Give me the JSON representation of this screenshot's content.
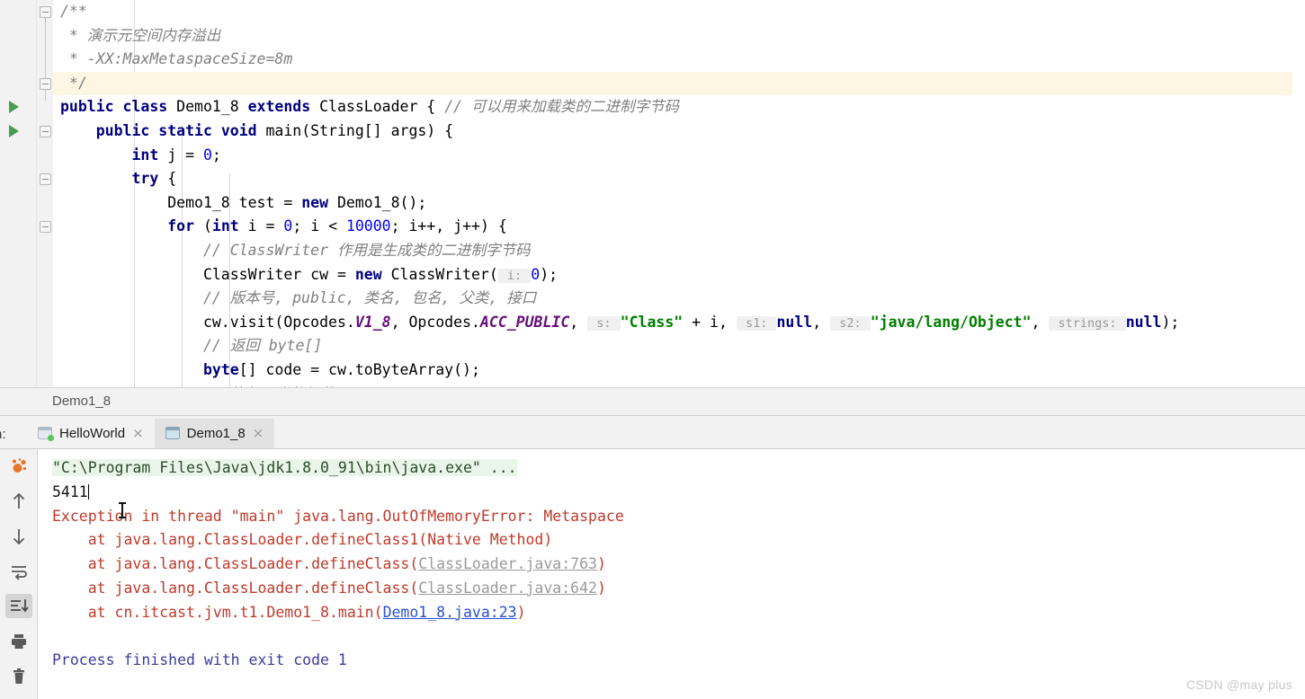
{
  "editor": {
    "lines": [
      {
        "indent": 0,
        "tokens": [
          {
            "t": "doc",
            "v": "/**"
          }
        ]
      },
      {
        "indent": 0,
        "tokens": [
          {
            "t": "doc",
            "v": " * 演示元空间内存溢出"
          }
        ]
      },
      {
        "indent": 0,
        "tokens": [
          {
            "t": "doc",
            "v": " * -XX:MaxMetaspaceSize=8m"
          }
        ]
      },
      {
        "indent": 0,
        "highlight": true,
        "tokens": [
          {
            "t": "doc",
            "v": " */"
          }
        ]
      },
      {
        "indent": 0,
        "tokens": [
          {
            "t": "kw",
            "v": "public class"
          },
          {
            "t": "plain",
            "v": " Demo1_8 "
          },
          {
            "t": "kw",
            "v": "extends"
          },
          {
            "t": "plain",
            "v": " ClassLoader { "
          },
          {
            "t": "cmt",
            "v": "// 可以用来加载类的二进制字节码"
          }
        ]
      },
      {
        "indent": 0,
        "tokens": [
          {
            "t": "plain",
            "v": "    "
          },
          {
            "t": "kw",
            "v": "public static void"
          },
          {
            "t": "plain",
            "v": " main(String[] args) {"
          }
        ]
      },
      {
        "indent": 0,
        "tokens": [
          {
            "t": "plain",
            "v": "        "
          },
          {
            "t": "kw",
            "v": "int"
          },
          {
            "t": "plain",
            "v": " j = "
          },
          {
            "t": "num",
            "v": "0"
          },
          {
            "t": "plain",
            "v": ";"
          }
        ]
      },
      {
        "indent": 0,
        "tokens": [
          {
            "t": "plain",
            "v": "        "
          },
          {
            "t": "kw",
            "v": "try"
          },
          {
            "t": "plain",
            "v": " {"
          }
        ]
      },
      {
        "indent": 0,
        "tokens": [
          {
            "t": "plain",
            "v": "            Demo1_8 test = "
          },
          {
            "t": "kw",
            "v": "new"
          },
          {
            "t": "plain",
            "v": " Demo1_8();"
          }
        ]
      },
      {
        "indent": 0,
        "tokens": [
          {
            "t": "plain",
            "v": "            "
          },
          {
            "t": "kw",
            "v": "for"
          },
          {
            "t": "plain",
            "v": " ("
          },
          {
            "t": "kw",
            "v": "int"
          },
          {
            "t": "plain",
            "v": " i = "
          },
          {
            "t": "num",
            "v": "0"
          },
          {
            "t": "plain",
            "v": "; i < "
          },
          {
            "t": "num",
            "v": "10000"
          },
          {
            "t": "plain",
            "v": "; i++, j++) {"
          }
        ]
      },
      {
        "indent": 0,
        "tokens": [
          {
            "t": "plain",
            "v": "                "
          },
          {
            "t": "cmt",
            "v": "// ClassWriter 作用是生成类的二进制字节码"
          }
        ]
      },
      {
        "indent": 0,
        "tokens": [
          {
            "t": "plain",
            "v": "                ClassWriter cw = "
          },
          {
            "t": "kw",
            "v": "new"
          },
          {
            "t": "plain",
            "v": " ClassWriter("
          },
          {
            "t": "hint",
            "v": " i: "
          },
          {
            "t": "num",
            "v": "0"
          },
          {
            "t": "plain",
            "v": ");"
          }
        ]
      },
      {
        "indent": 0,
        "tokens": [
          {
            "t": "plain",
            "v": "                "
          },
          {
            "t": "cmt",
            "v": "// 版本号, public, 类名, 包名, 父类, 接口"
          }
        ]
      },
      {
        "indent": 0,
        "tokens": [
          {
            "t": "plain",
            "v": "                cw.visit(Opcodes."
          },
          {
            "t": "stat",
            "v": "V1_8"
          },
          {
            "t": "plain",
            "v": ", Opcodes."
          },
          {
            "t": "stat",
            "v": "ACC_PUBLIC"
          },
          {
            "t": "plain",
            "v": ", "
          },
          {
            "t": "hint",
            "v": " s: "
          },
          {
            "t": "str",
            "v": "\"Class\""
          },
          {
            "t": "plain",
            "v": " + i, "
          },
          {
            "t": "hint",
            "v": " s1: "
          },
          {
            "t": "kw",
            "v": "null"
          },
          {
            "t": "plain",
            "v": ", "
          },
          {
            "t": "hint",
            "v": " s2: "
          },
          {
            "t": "str",
            "v": "\"java/lang/Object\""
          },
          {
            "t": "plain",
            "v": ", "
          },
          {
            "t": "hint",
            "v": " strings: "
          },
          {
            "t": "kw",
            "v": "null"
          },
          {
            "t": "plain",
            "v": ");"
          }
        ]
      },
      {
        "indent": 0,
        "tokens": [
          {
            "t": "plain",
            "v": "                "
          },
          {
            "t": "cmt",
            "v": "// 返回 byte[]"
          }
        ]
      },
      {
        "indent": 0,
        "tokens": [
          {
            "t": "plain",
            "v": "                "
          },
          {
            "t": "kw",
            "v": "byte"
          },
          {
            "t": "plain",
            "v": "[] code = cw.toByteArray();"
          }
        ]
      },
      {
        "indent": 0,
        "tokens": [
          {
            "t": "plain",
            "v": "                "
          },
          {
            "t": "cmt",
            "v": "// 执行了类的加载"
          }
        ]
      }
    ],
    "gutter": {
      "run_arrow_lines": [
        4,
        5
      ],
      "fold_lines": [
        0,
        3,
        5,
        7,
        9
      ]
    }
  },
  "breadcrumb": {
    "crumb": "Demo1_8"
  },
  "run_window": {
    "label": "n:",
    "full_label": "Run:",
    "tabs": [
      {
        "name": "HelloWorld",
        "active": false,
        "running_dot": true,
        "close": "×"
      },
      {
        "name": "Demo1_8",
        "active": true,
        "running_dot": false,
        "close": "×"
      }
    ],
    "toolbar": [
      {
        "icon": "rerun-icon",
        "selected": false
      },
      {
        "icon": "up-arrow-icon",
        "selected": false
      },
      {
        "icon": "down-arrow-icon",
        "selected": false
      },
      {
        "icon": "soft-wrap-icon",
        "selected": false
      },
      {
        "icon": "scroll-to-end-icon",
        "selected": true
      },
      {
        "icon": "print-icon",
        "selected": false
      },
      {
        "icon": "trash-icon",
        "selected": false
      }
    ],
    "console": [
      {
        "type": "cmd",
        "text": "\"C:\\Program Files\\Java\\jdk1.8.0_91\\bin\\java.exe\" ..."
      },
      {
        "type": "out",
        "text": "5411"
      },
      {
        "type": "err",
        "text": "Exception in thread \"main\" java.lang.OutOfMemoryError: Metaspace"
      },
      {
        "type": "err",
        "text": "    at java.lang.ClassLoader.defineClass1(Native Method)"
      },
      {
        "type": "err_link",
        "prefix": "    at java.lang.ClassLoader.defineClass(",
        "link": "ClassLoader.java:763",
        "link_style": "grey",
        "suffix": ")"
      },
      {
        "type": "err_link",
        "prefix": "    at java.lang.ClassLoader.defineClass(",
        "link": "ClassLoader.java:642",
        "link_style": "grey",
        "suffix": ")"
      },
      {
        "type": "err_link",
        "prefix": "    at cn.itcast.jvm.t1.Demo1_8.main(",
        "link": "Demo1_8.java:23",
        "link_style": "blue",
        "suffix": ")"
      },
      {
        "type": "blank",
        "text": ""
      },
      {
        "type": "finished",
        "text": "Process finished with exit code 1"
      }
    ]
  },
  "watermark": "CSDN @may plus",
  "colors": {
    "keyword": "#000080",
    "string": "#008000",
    "comment": "#808080",
    "number": "#0000ff",
    "static_field": "#660e7a",
    "error": "#c0392b",
    "command_bg": "#eaf5ea",
    "finished": "#3b3b9e",
    "run_arrow": "#499c54",
    "highlight_line": "#fdf6e3"
  }
}
